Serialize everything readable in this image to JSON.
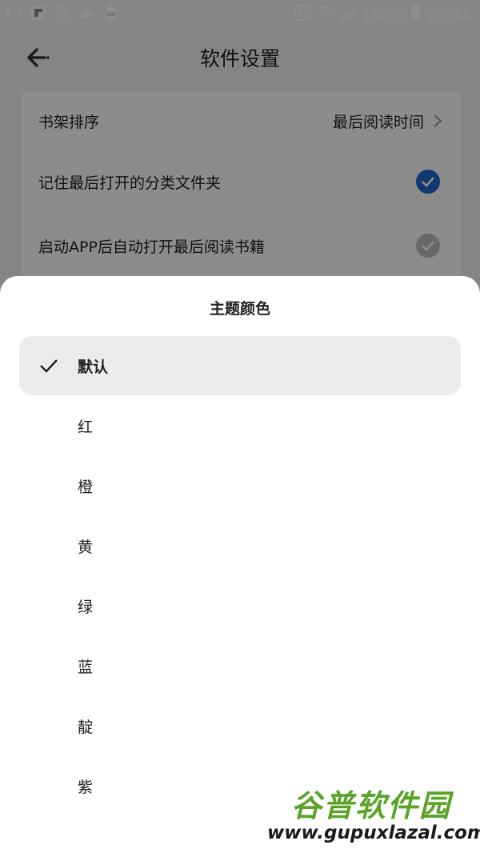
{
  "statusbar": {
    "battery_icon_text": "100",
    "battery_percent": "100%",
    "time": "22:44",
    "icons": [
      "gmail-icon",
      "flipboard-icon",
      "sim-icon",
      "cloud-icon",
      "battery-saver-icon",
      "nfc-icon",
      "wifi-icon",
      "signal-icon",
      "battery-icon"
    ]
  },
  "appbar": {
    "title": "软件设置"
  },
  "settings": {
    "rows": [
      {
        "label": "书架排序",
        "value": "最后阅读时间"
      },
      {
        "label": "记住最后打开的分类文件夹",
        "checked": true
      },
      {
        "label": "启动APP后自动打开最后阅读书籍",
        "checked": true
      }
    ]
  },
  "sheet": {
    "title": "主题颜色",
    "options": [
      {
        "label": "默认",
        "selected": true
      },
      {
        "label": "红",
        "selected": false
      },
      {
        "label": "橙",
        "selected": false
      },
      {
        "label": "黄",
        "selected": false
      },
      {
        "label": "绿",
        "selected": false
      },
      {
        "label": "蓝",
        "selected": false
      },
      {
        "label": "靛",
        "selected": false
      },
      {
        "label": "紫",
        "selected": false
      }
    ]
  },
  "watermark": {
    "name": "谷普软件园",
    "url": "www.gupuxlazal.com"
  },
  "colors": {
    "accent_check": "#1e66c8",
    "watermark_green": "#5aa428"
  }
}
